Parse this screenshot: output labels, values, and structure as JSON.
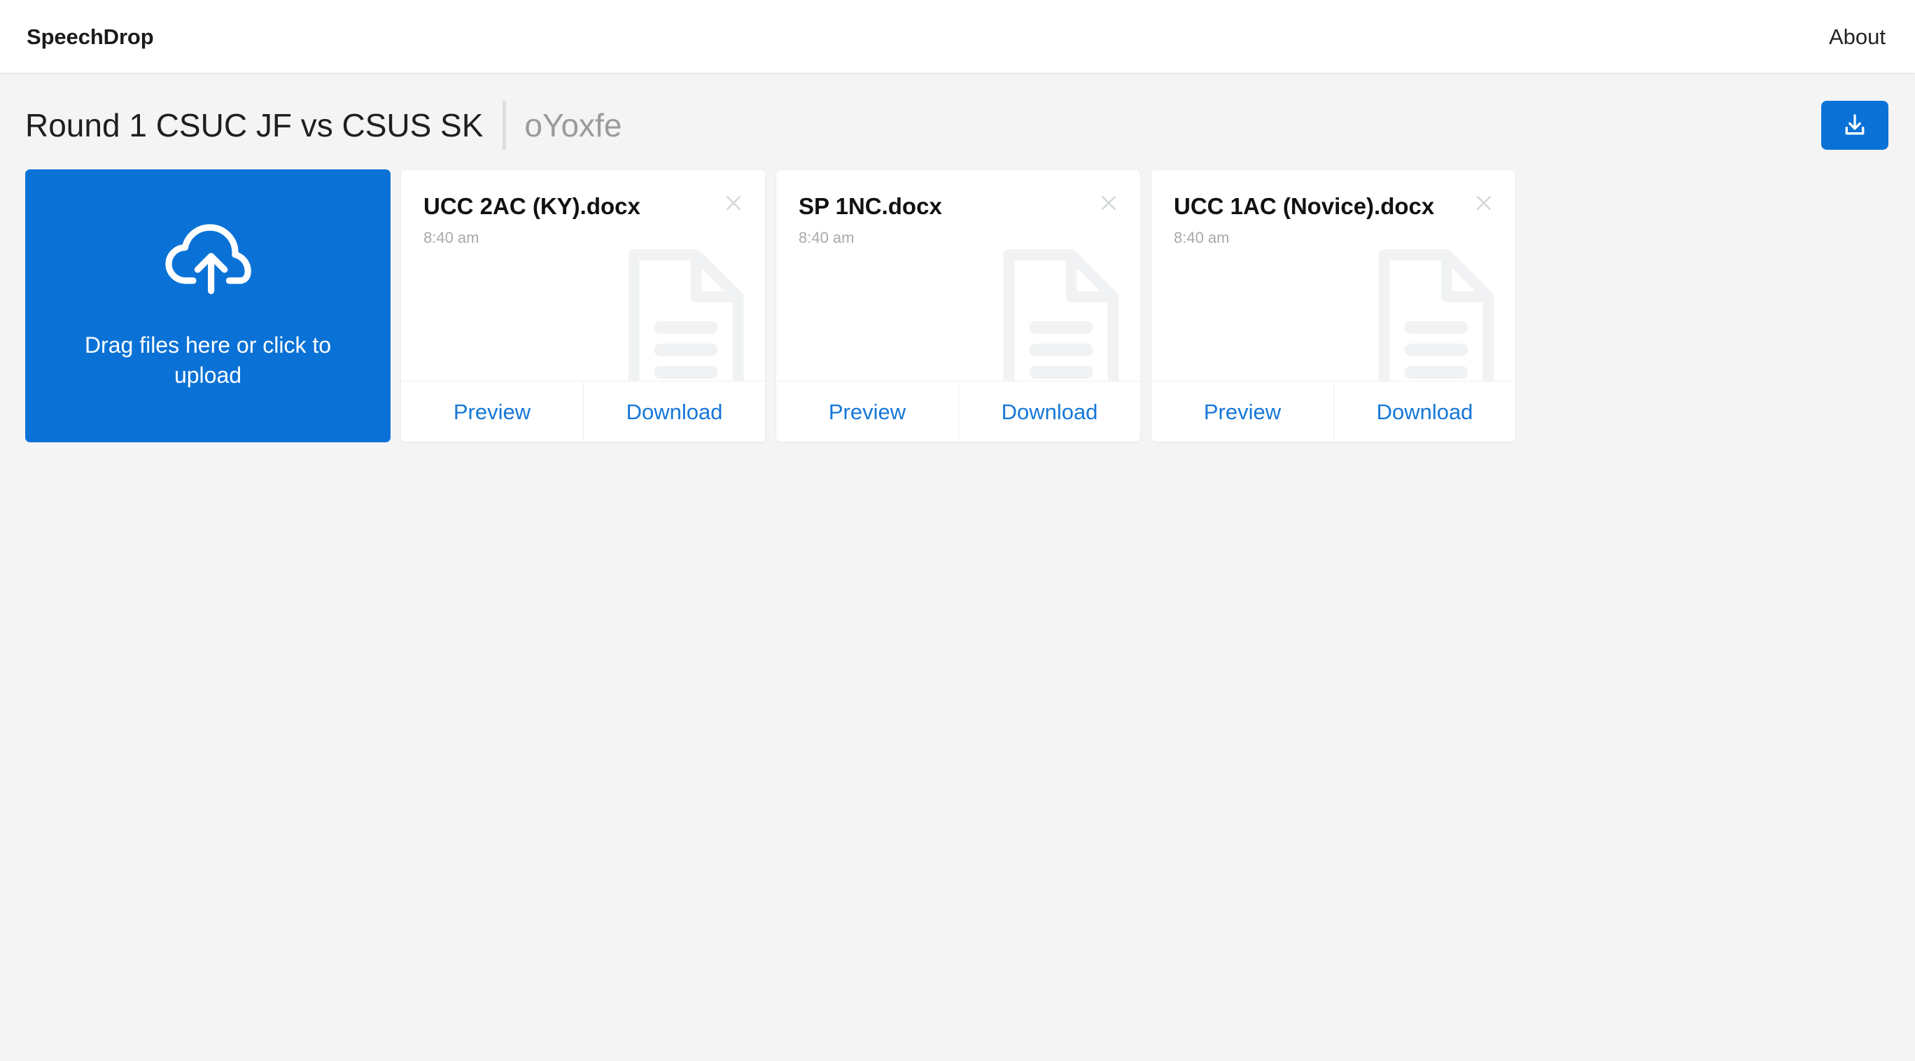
{
  "header": {
    "brand": "SpeechDrop",
    "about_label": "About"
  },
  "room": {
    "title": "Round 1 CSUC JF vs CSUS SK",
    "code": "oYoxfe",
    "download_all_icon": "download-icon"
  },
  "dropzone": {
    "icon": "cloud-upload-icon",
    "text": "Drag files here or click to upload"
  },
  "card_actions": {
    "preview_label": "Preview",
    "download_label": "Download",
    "close_icon": "close-icon",
    "watermark_icon": "document-icon"
  },
  "files": [
    {
      "name": "UCC 2AC (KY).docx",
      "time": "8:40 am"
    },
    {
      "name": "SP 1NC.docx",
      "time": "8:40 am"
    },
    {
      "name": "UCC 1AC (Novice).docx",
      "time": "8:40 am"
    }
  ],
  "colors": {
    "accent": "#0a72d6",
    "link": "#1577d8",
    "page_background": "#f4f4f5",
    "card_background": "#ffffff",
    "muted_text": "#a9a9ad",
    "watermark": "#f1f2f3"
  }
}
